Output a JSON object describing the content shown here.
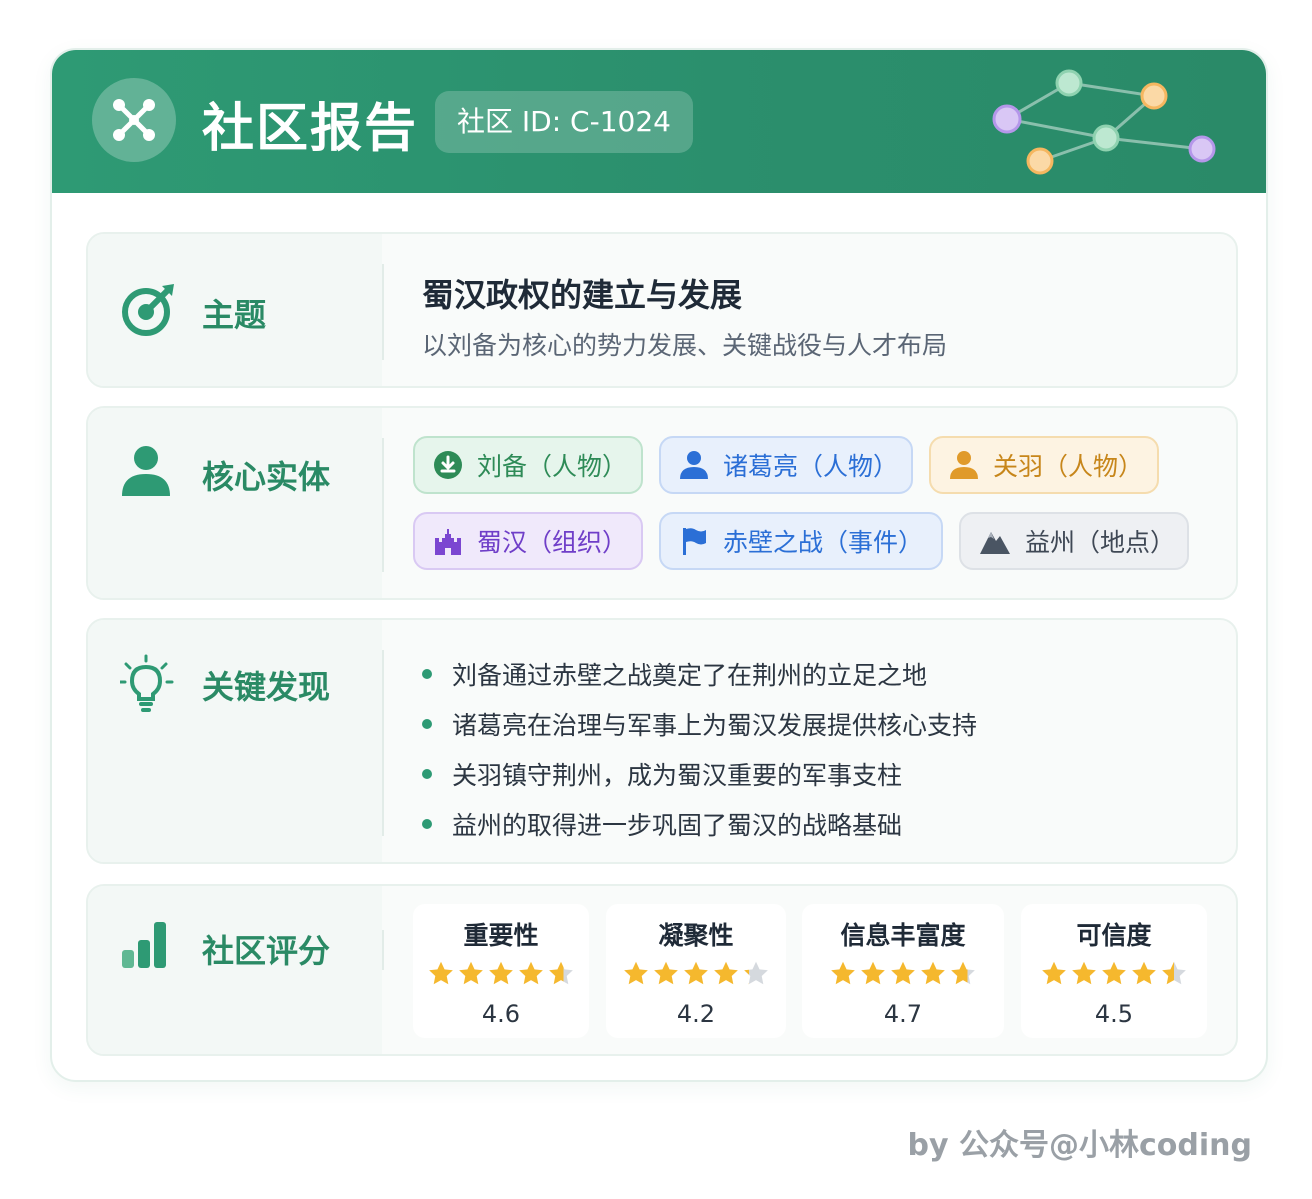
{
  "header": {
    "title": "社区报告",
    "badge": "社区 ID: C-1024",
    "icon": "network-nodes-icon"
  },
  "topic": {
    "label": "主题",
    "title": "蜀汉政权的建立与发展",
    "subtitle": "以刘备为核心的势力发展、关键战役与人才布局"
  },
  "entities": {
    "label": "核心实体",
    "items": [
      {
        "label": "刘备（人物）",
        "icon": "download-circle-icon",
        "color": "#2e8b57"
      },
      {
        "label": "诸葛亮（人物）",
        "icon": "person-icon",
        "color": "#2b6fd6"
      },
      {
        "label": "关羽（人物）",
        "icon": "person-icon",
        "color": "#d4901c"
      },
      {
        "label": "蜀汉（组织）",
        "icon": "castle-icon",
        "color": "#6f3ec8"
      },
      {
        "label": "赤壁之战（事件）",
        "icon": "flag-icon",
        "color": "#2b6fd6"
      },
      {
        "label": "益州（地点）",
        "icon": "mountain-icon",
        "color": "#4a5563"
      }
    ]
  },
  "findings": {
    "label": "关键发现",
    "items": [
      "刘备通过赤壁之战奠定了在荆州的立足之地",
      "诸葛亮在治理与军事上为蜀汉发展提供核心支持",
      "关羽镇守荆州，成为蜀汉重要的军事支柱",
      "益州的取得进一步巩固了蜀汉的战略基础"
    ]
  },
  "scores": {
    "label": "社区评分",
    "items": [
      {
        "name": "重要性",
        "value": "4.6",
        "rating": 4.6
      },
      {
        "name": "凝聚性",
        "value": "4.2",
        "rating": 4.2
      },
      {
        "name": "信息丰富度",
        "value": "4.7",
        "rating": 4.7
      },
      {
        "name": "可信度",
        "value": "4.5",
        "rating": 4.5
      }
    ]
  },
  "footer": "by 公众号@小林coding",
  "colors": {
    "brand": "#2e9a74",
    "star": "#f5b82e",
    "star_empty": "#d5d9de"
  }
}
